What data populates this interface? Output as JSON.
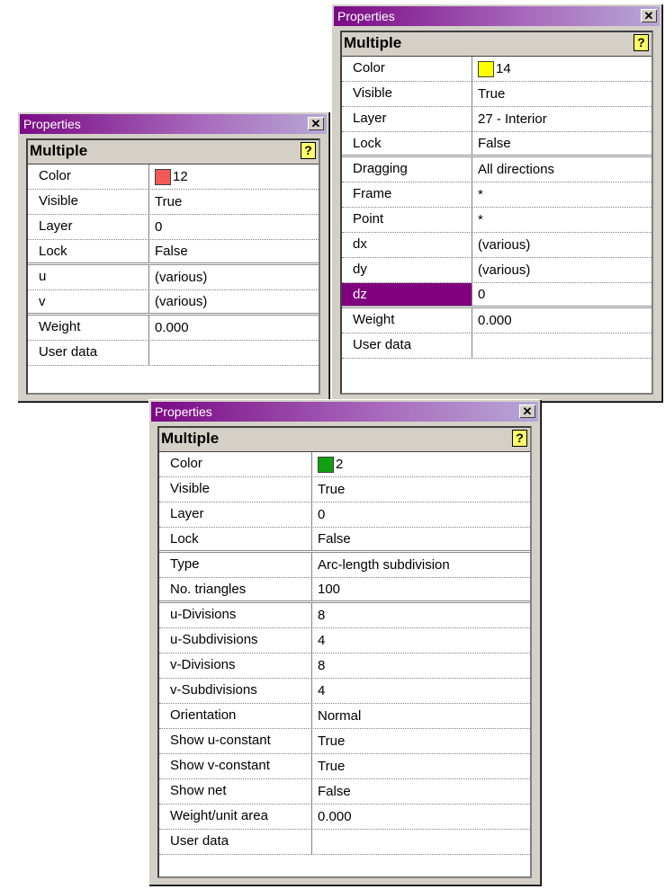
{
  "windows": [
    {
      "title": "Properties",
      "header": "Multiple",
      "rows": [
        {
          "key": "Color",
          "value": "12",
          "swatch": "#f25a5a"
        },
        {
          "key": "Visible",
          "value": "True"
        },
        {
          "key": "Layer",
          "value": "0"
        },
        {
          "key": "Lock",
          "value": "False",
          "group_end": true
        },
        {
          "key": "u",
          "value": "(various)"
        },
        {
          "key": "v",
          "value": "(various)",
          "group_end": true
        },
        {
          "key": "Weight",
          "value": "0.000"
        },
        {
          "key": "User data",
          "value": ""
        }
      ]
    },
    {
      "title": "Properties",
      "header": "Multiple",
      "rows": [
        {
          "key": "Color",
          "value": "14",
          "swatch": "#ffff00"
        },
        {
          "key": "Visible",
          "value": "True"
        },
        {
          "key": "Layer",
          "value": "27 - Interior"
        },
        {
          "key": "Lock",
          "value": "False",
          "group_end": true
        },
        {
          "key": "Dragging",
          "value": "All directions"
        },
        {
          "key": "Frame",
          "value": "*"
        },
        {
          "key": "Point",
          "value": "*"
        },
        {
          "key": "dx",
          "value": "(various)"
        },
        {
          "key": "dy",
          "value": "(various)"
        },
        {
          "key": "dz",
          "value": "0",
          "selected": true,
          "group_end": true
        },
        {
          "key": "Weight",
          "value": "0.000"
        },
        {
          "key": "User data",
          "value": ""
        }
      ]
    },
    {
      "title": "Properties",
      "header": "Multiple",
      "rows": [
        {
          "key": "Color",
          "value": "2",
          "swatch": "#10a010"
        },
        {
          "key": "Visible",
          "value": "True"
        },
        {
          "key": "Layer",
          "value": "0"
        },
        {
          "key": "Lock",
          "value": "False",
          "group_end": true
        },
        {
          "key": "Type",
          "value": "Arc-length subdivision"
        },
        {
          "key": "No. triangles",
          "value": "100",
          "group_end": true
        },
        {
          "key": "u-Divisions",
          "value": "8"
        },
        {
          "key": "u-Subdivisions",
          "value": "4"
        },
        {
          "key": "v-Divisions",
          "value": "8"
        },
        {
          "key": "v-Subdivisions",
          "value": "4"
        },
        {
          "key": "Orientation",
          "value": "Normal"
        },
        {
          "key": "Show u-constant",
          "value": "True"
        },
        {
          "key": "Show v-constant",
          "value": "True"
        },
        {
          "key": "Show net",
          "value": "False"
        },
        {
          "key": "Weight/unit area",
          "value": "0.000"
        },
        {
          "key": "User data",
          "value": ""
        }
      ]
    }
  ],
  "icons": {
    "close": "close-icon",
    "help": "help-icon"
  },
  "colors": {
    "titlebar_start": "#7a0a85",
    "selected_row": "#800080"
  }
}
